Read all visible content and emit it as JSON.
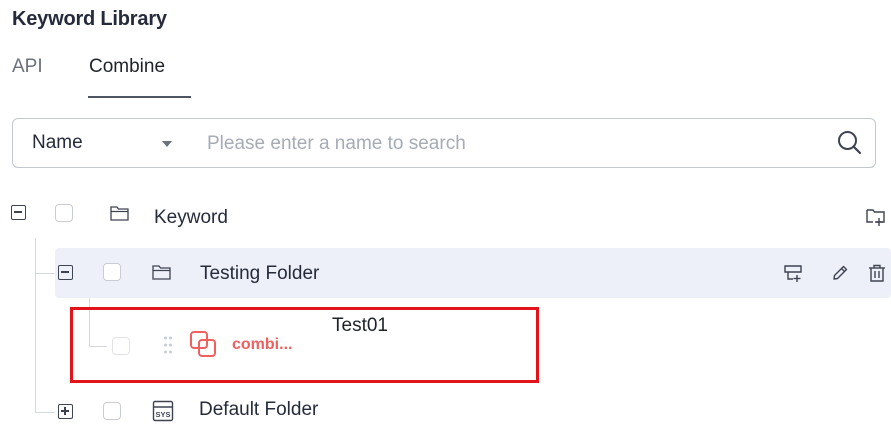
{
  "header": {
    "title": "Keyword Library"
  },
  "tabs": [
    {
      "label": "API",
      "active": false
    },
    {
      "label": "Combine",
      "active": true
    }
  ],
  "search": {
    "field_label": "Name",
    "placeholder": "Please enter a name to search",
    "value": ""
  },
  "tree": {
    "root": {
      "label": "Keyword",
      "expanded": true
    },
    "folders": [
      {
        "label": "Testing Folder",
        "expanded": true,
        "selected": true,
        "children": [
          {
            "label": "combi...",
            "type": "combine-keyword"
          }
        ]
      },
      {
        "label": "Default Folder",
        "expanded": false,
        "badge": "SYS"
      }
    ]
  },
  "annotation": {
    "label": "Test01",
    "color": "#e1141b"
  },
  "colors": {
    "accent_red": "#f0605f",
    "row_selected": "#eef0f9"
  }
}
